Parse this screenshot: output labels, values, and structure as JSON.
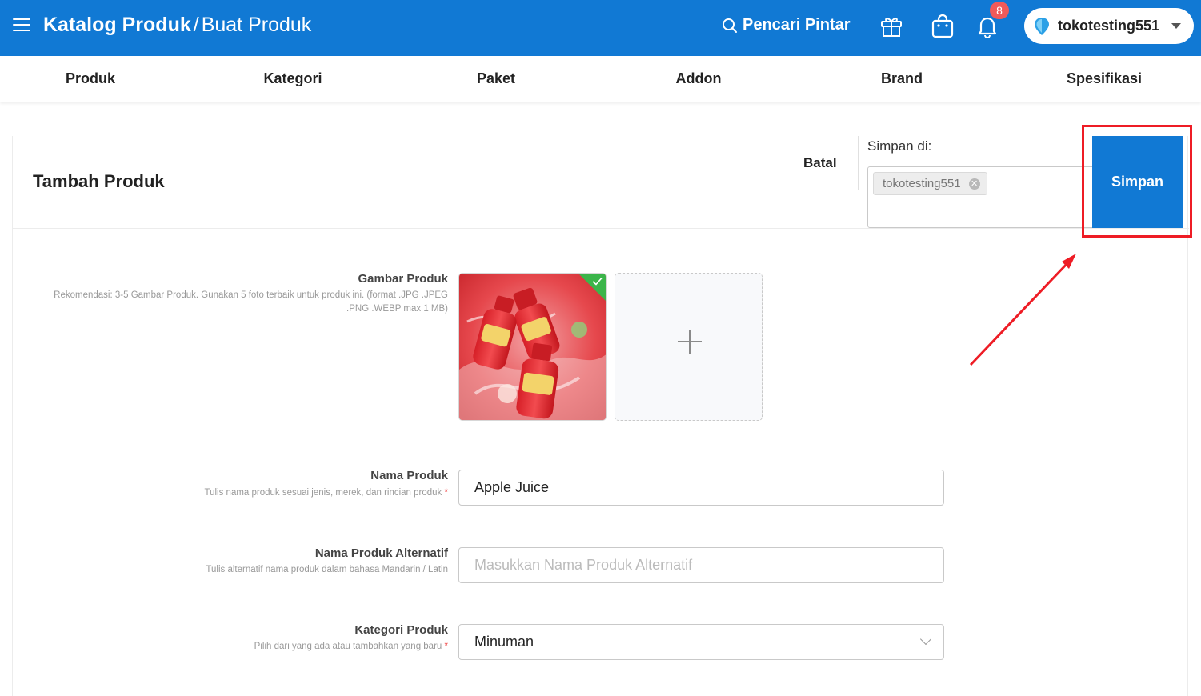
{
  "header": {
    "breadcrumb_main": "Katalog Produk",
    "breadcrumb_sep": "/",
    "breadcrumb_sub": "Buat Produk",
    "smart_search_label": "Pencari Pintar",
    "notification_count": "8",
    "store_name": "tokotesting551",
    "icons": [
      "menu-icon",
      "search-icon",
      "gift-icon",
      "shopping-bag-icon",
      "bell-icon",
      "location-pin-icon",
      "caret-down-icon"
    ]
  },
  "tabs": [
    "Produk",
    "Kategori",
    "Paket",
    "Addon",
    "Brand",
    "Spesifikasi"
  ],
  "card": {
    "title": "Tambah Produk",
    "cancel_label": "Batal",
    "save_in_label": "Simpan di:",
    "save_in_chip": "tokotesting551",
    "save_button": "Simpan"
  },
  "form": {
    "image": {
      "label": "Gambar Produk",
      "hint": "Rekomendasi: 3-5 Gambar Produk. Gunakan 5 foto terbaik untuk produk ini. (format .JPG .JPEG .PNG .WEBP max 1 MB)"
    },
    "name": {
      "label": "Nama Produk",
      "hint": "Tulis nama produk sesuai jenis, merek, dan rincian produk",
      "required_mark": "*",
      "value": "Apple Juice"
    },
    "alt_name": {
      "label": "Nama Produk Alternatif",
      "hint": "Tulis alternatif nama produk dalam bahasa Mandarin / Latin",
      "placeholder": "Masukkan Nama Produk Alternatif"
    },
    "category": {
      "label": "Kategori Produk",
      "hint": "Pilih dari yang ada atau tambahkan yang baru",
      "required_mark": "*",
      "value": "Minuman"
    }
  },
  "colors": {
    "primary": "#1179d4",
    "highlight": "#ee1c25",
    "badge": "#f05a5a",
    "check": "#3bb54a"
  }
}
